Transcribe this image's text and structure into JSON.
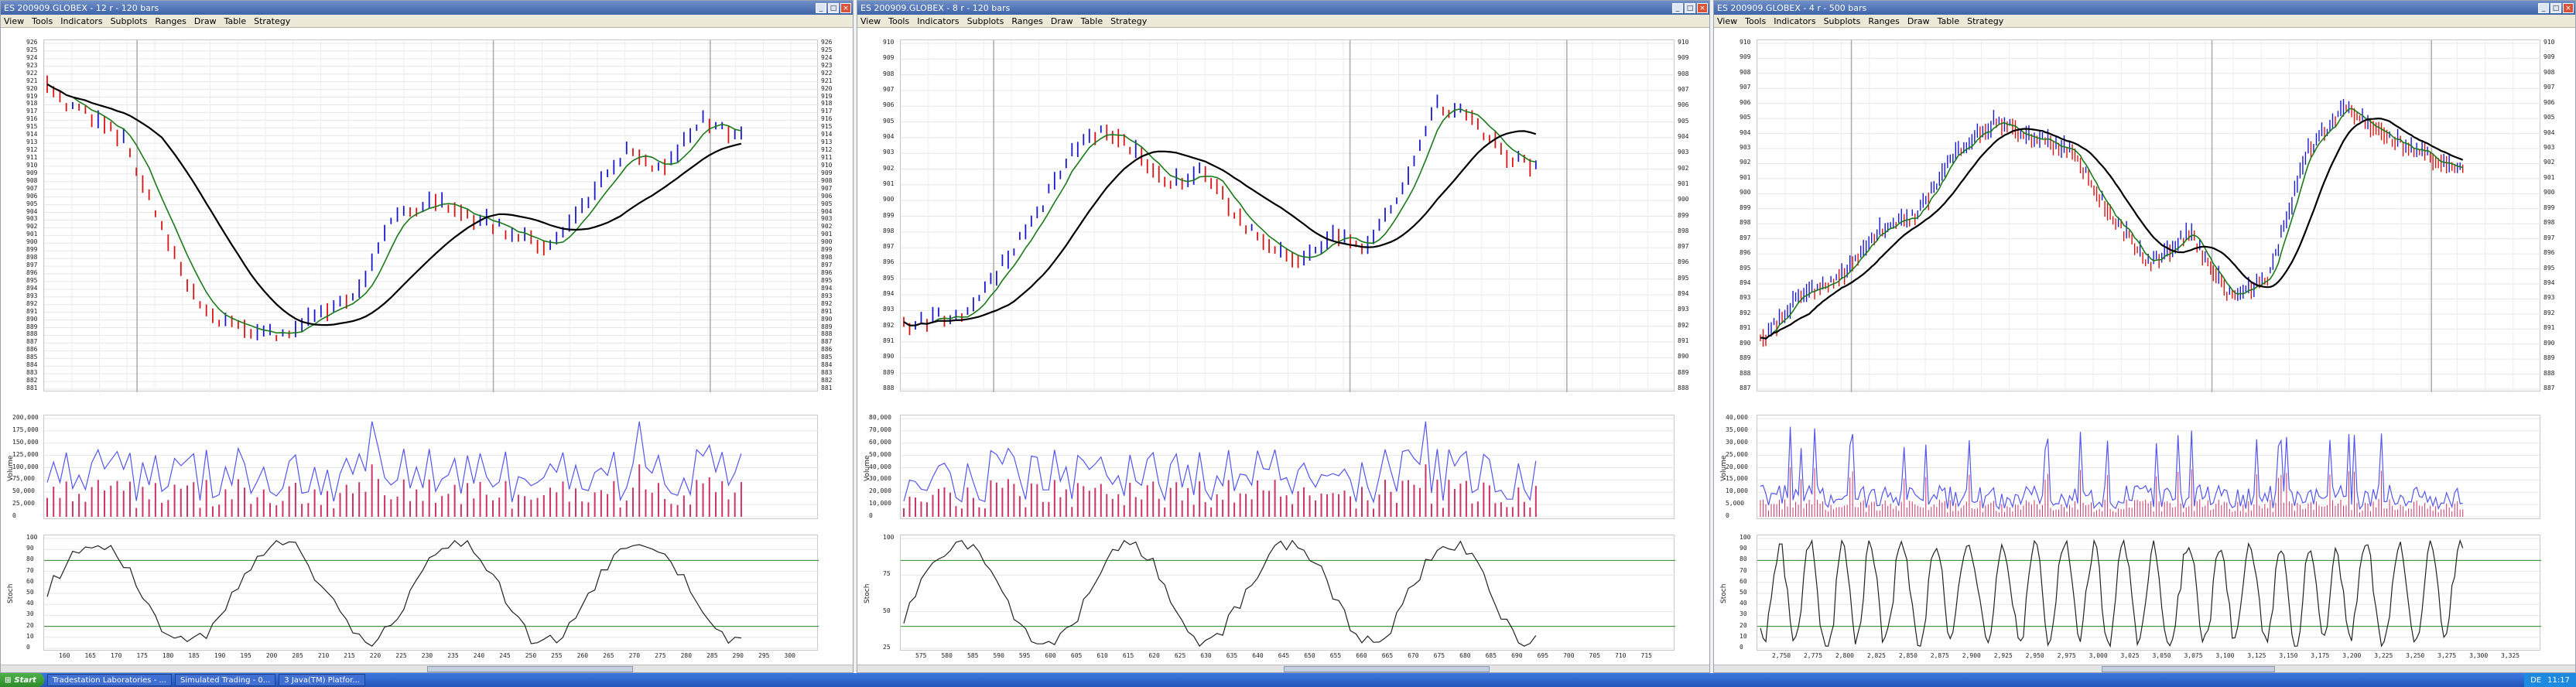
{
  "windows": [
    {
      "title": "ES 200909.GLOBEX - 12 r - 120 bars",
      "menu": [
        "View",
        "Tools",
        "Indicators",
        "Subplots",
        "Ranges",
        "Draw",
        "Table",
        "Strategy"
      ],
      "price_axis": [
        "926",
        "925",
        "924",
        "923",
        "922",
        "921",
        "920",
        "919",
        "918",
        "917",
        "916",
        "915",
        "914",
        "913",
        "912",
        "911",
        "910",
        "909",
        "908",
        "907",
        "906",
        "905",
        "904",
        "903",
        "902",
        "901",
        "900",
        "899",
        "898",
        "897",
        "896",
        "895",
        "894",
        "893",
        "892",
        "891",
        "890",
        "889",
        "888",
        "887",
        "886",
        "885",
        "884",
        "883",
        "882",
        "881"
      ],
      "volume_label": "Volume",
      "volume_ticks": [
        "200,000",
        "175,000",
        "150,000",
        "125,000",
        "100,000",
        "75,000",
        "50,000",
        "25,000",
        "0"
      ],
      "stoch_label": "Stoch",
      "stoch_ticks": [
        "100",
        "90",
        "80",
        "70",
        "60",
        "50",
        "40",
        "30",
        "20",
        "10",
        "0"
      ],
      "x_ticks": [
        "160",
        "165",
        "170",
        "175",
        "180",
        "185",
        "190",
        "195",
        "200",
        "205",
        "210",
        "215",
        "220",
        "225",
        "230",
        "235",
        "240",
        "245",
        "250",
        "255",
        "260",
        "265",
        "270",
        "275",
        "280",
        "285",
        "290",
        "295",
        "300"
      ]
    },
    {
      "title": "ES 200909.GLOBEX - 8 r - 120 bars",
      "menu": [
        "View",
        "Tools",
        "Indicators",
        "Subplots",
        "Ranges",
        "Draw",
        "Table",
        "Strategy"
      ],
      "price_axis": [
        "910",
        "909",
        "908",
        "907",
        "906",
        "905",
        "904",
        "903",
        "902",
        "901",
        "900",
        "899",
        "898",
        "897",
        "896",
        "895",
        "894",
        "893",
        "892",
        "891",
        "890",
        "889",
        "888"
      ],
      "volume_label": "Volume",
      "volume_ticks": [
        "80,000",
        "70,000",
        "60,000",
        "50,000",
        "40,000",
        "30,000",
        "20,000",
        "10,000",
        "0"
      ],
      "stoch_label": "Stoch",
      "stoch_ticks": [
        "100",
        "75",
        "50",
        "25"
      ],
      "x_ticks": [
        "575",
        "580",
        "585",
        "590",
        "595",
        "600",
        "605",
        "610",
        "615",
        "620",
        "625",
        "630",
        "635",
        "640",
        "645",
        "650",
        "655",
        "660",
        "665",
        "670",
        "675",
        "680",
        "685",
        "690",
        "695",
        "700",
        "705",
        "710",
        "715"
      ]
    },
    {
      "title": "ES 200909.GLOBEX - 4 r - 500 bars",
      "menu": [
        "View",
        "Tools",
        "Indicators",
        "Subplots",
        "Ranges",
        "Draw",
        "Table",
        "Strategy"
      ],
      "price_axis": [
        "910",
        "909",
        "908",
        "907",
        "906",
        "905",
        "904",
        "903",
        "902",
        "901",
        "900",
        "899",
        "898",
        "897",
        "896",
        "895",
        "894",
        "893",
        "892",
        "891",
        "890",
        "889",
        "888",
        "887"
      ],
      "volume_label": "Volume",
      "volume_ticks": [
        "40,000",
        "35,000",
        "30,000",
        "25,000",
        "20,000",
        "15,000",
        "10,000",
        "5,000",
        "0"
      ],
      "stoch_label": "Stoch",
      "stoch_ticks": [
        "100",
        "90",
        "80",
        "70",
        "60",
        "50",
        "40",
        "30",
        "20",
        "10",
        "0"
      ],
      "x_ticks": [
        "2,750",
        "2,775",
        "2,800",
        "2,825",
        "2,850",
        "2,875",
        "2,900",
        "2,925",
        "2,950",
        "2,975",
        "3,000",
        "3,025",
        "3,050",
        "3,075",
        "3,100",
        "3,125",
        "3,150",
        "3,175",
        "3,200",
        "3,225",
        "3,250",
        "3,275",
        "3,300",
        "3,325"
      ]
    }
  ],
  "taskbar": {
    "start_label": "Start",
    "items": [
      "Tradestation Laboratories - ...",
      "Simulated Trading - 0...",
      "3 Java(TM) Platfor..."
    ],
    "tray_lang": "DE",
    "clock": "11:17"
  },
  "colors": {
    "up": "#1a1acc",
    "down": "#d91414",
    "ma_fast": "#1a7a1a",
    "ma_slow": "#000000",
    "vol_line": "#5555ee",
    "vol_bar": "#cc3366"
  }
}
